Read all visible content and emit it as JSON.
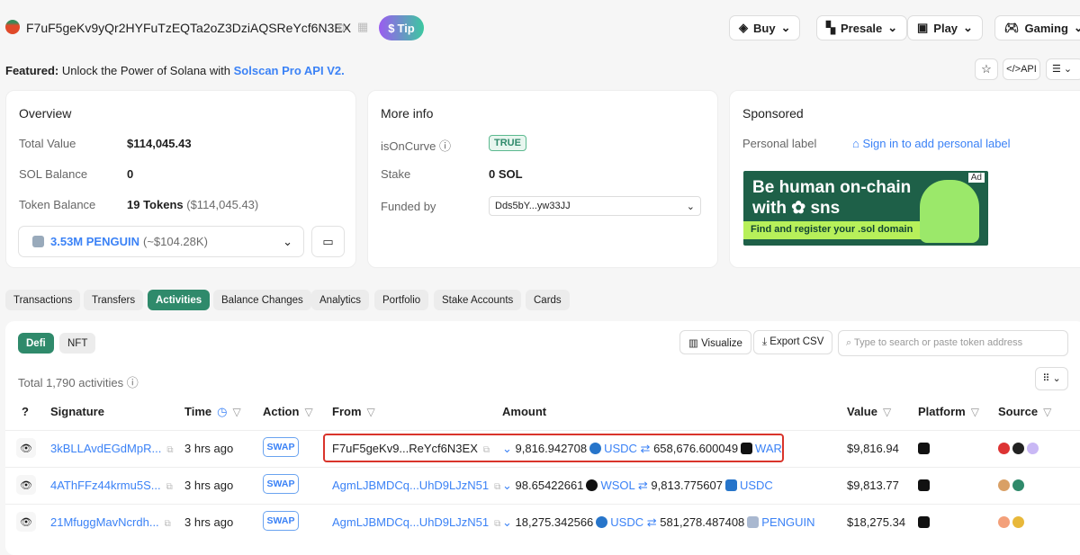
{
  "header": {
    "address": "F7uF5geKv9yQr2HYFuTzEQTa2oZ3DziAQSReYcf6N3EX",
    "tip": "Tip",
    "buttons": [
      "Buy",
      "Presale",
      "Play",
      "Gaming"
    ],
    "api": "API"
  },
  "featured": {
    "label": "Featured:",
    "text": "Unlock the Power of Solana with",
    "link": "Solscan Pro API V2."
  },
  "overview": {
    "title": "Overview",
    "total_value_label": "Total Value",
    "total_value": "$114,045.43",
    "sol_label": "SOL Balance",
    "sol": "0",
    "token_label": "Token Balance",
    "token": "19 Tokens",
    "token_usd": "($114,045.43)",
    "selected_token": "3.53M PENGUIN",
    "selected_usd": "(~$104.28K)"
  },
  "more_info": {
    "title": "More info",
    "oncurve_label": "isOnCurve",
    "oncurve": "TRUE",
    "stake_label": "Stake",
    "stake": "0 SOL",
    "funded_label": "Funded by",
    "funded": "Dds5bY...yw33JJ"
  },
  "sponsored": {
    "title": "Sponsored",
    "personal_label": "Personal label",
    "sign_in": "Sign in to add personal label",
    "ad": "Ad",
    "ad_line1": "Be human on-chain",
    "ad_line2": "with",
    "ad_brand": "sns",
    "ad_cta": "Find and register your .sol domain"
  },
  "tabs": [
    "Transactions",
    "Transfers",
    "Activities",
    "Balance Changes",
    "Analytics",
    "Portfolio",
    "Stake Accounts",
    "Cards"
  ],
  "subtabs": [
    "Defi",
    "NFT"
  ],
  "toolbar": {
    "visualize": "Visualize",
    "export": "Export CSV",
    "search_placeholder": "Type to search or paste token address"
  },
  "total": "Total 1,790 activities",
  "columns": [
    "Signature",
    "Time",
    "Action",
    "From",
    "Amount",
    "Value",
    "Platform",
    "Source"
  ],
  "rows": [
    {
      "sig": "3kBLLAvdEGdMpR...",
      "time": "3 hrs ago",
      "action": "SWAP",
      "from": "F7uF5geKv9...ReYcf6N3EX",
      "amt1": "9,816.942708",
      "tok1": "USDC",
      "amt2": "658,676.600049",
      "tok2": "WAR",
      "value": "$9,816.94"
    },
    {
      "sig": "4AThFFz44krmu5S...",
      "time": "3 hrs ago",
      "action": "SWAP",
      "from": "AgmLJBMDCq...UhD9LJzN51",
      "amt1": "98.65422661",
      "tok1": "WSOL",
      "amt2": "9,813.775607",
      "tok2": "USDC",
      "value": "$9,813.77"
    },
    {
      "sig": "21MfuggMavNcrdh...",
      "time": "3 hrs ago",
      "action": "SWAP",
      "from": "AgmLJBMDCq...UhD9LJzN51",
      "amt1": "18,275.342566",
      "tok1": "USDC",
      "amt2": "581,278.487408",
      "tok2": "PENGUIN",
      "value": "$18,275.34"
    }
  ]
}
